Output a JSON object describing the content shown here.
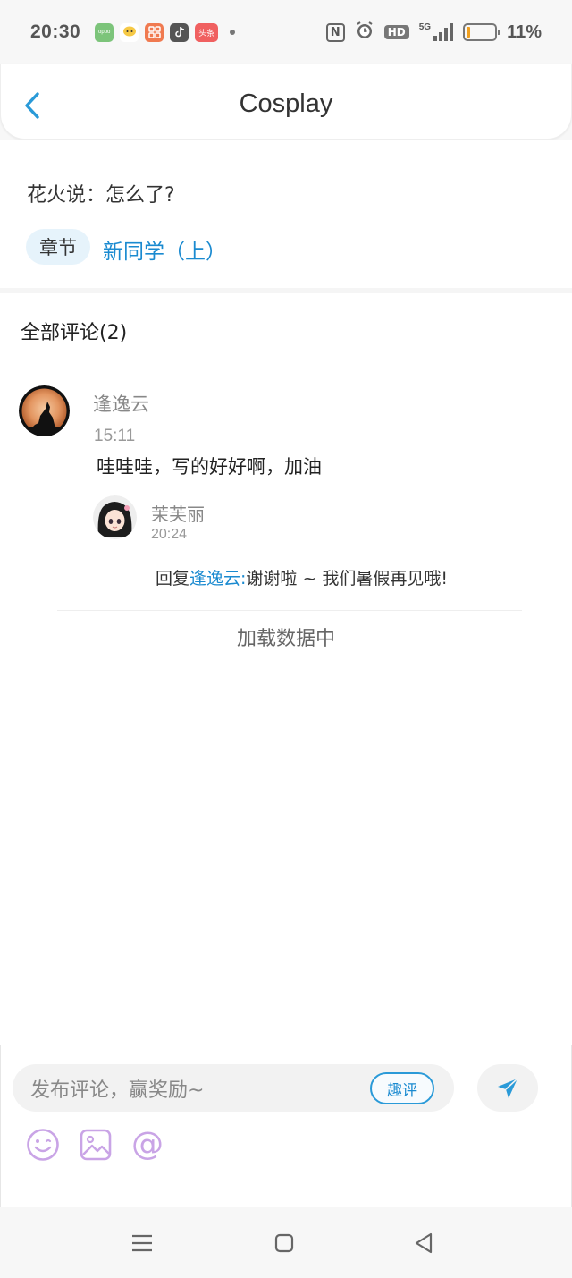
{
  "status_bar": {
    "time": "20:30",
    "network": "5G",
    "hd": "HD",
    "nfc": "N",
    "battery_percent": "11%",
    "battery_level": 0.11,
    "apps": [
      "oppo-icon",
      "chat-icon",
      "app-icon",
      "tiktok-icon",
      "toutiao-icon"
    ],
    "app_labels": {
      "toutiao": "头条"
    }
  },
  "header": {
    "title": "Cosplay",
    "back_icon": "chevron-left-icon"
  },
  "post": {
    "quote": "花火说：怎么了?",
    "chapter_tag": "章节",
    "chapter_title": "新同学（上）"
  },
  "comments": {
    "heading": "全部评论(2)",
    "items": [
      {
        "author": "逢逸云",
        "time": "15:11",
        "text": "哇哇哇，写的好好啊，加油",
        "replies": [
          {
            "author": "茉芙丽",
            "time": "20:24",
            "prefix": "回复",
            "target": "逢逸云:",
            "text": "谢谢啦 ~ 我们暑假再见哦!"
          }
        ]
      }
    ],
    "loading_text": "加载数据中"
  },
  "composer": {
    "placeholder": "发布评论，赢奖励~",
    "quping_label": "趣评",
    "send_icon": "send-icon",
    "tools": [
      "emoji-icon",
      "image-icon",
      "at-icon"
    ],
    "at_symbol": "@"
  },
  "colors": {
    "accent": "#1a8ad0",
    "send": "#2a9ad8",
    "tool_icons": "#c9a4e6",
    "chapter_tag_bg": "#e6f3fb"
  }
}
